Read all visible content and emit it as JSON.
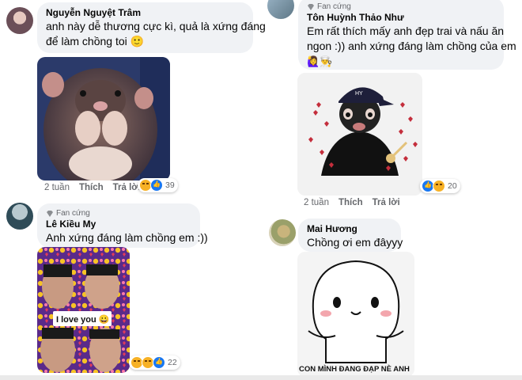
{
  "comments": [
    {
      "name": "Nguyễn Nguyệt Trâm",
      "text_lines": [
        "anh này dễ thương cực kì, quả là xứng đáng",
        "để làm chồng toi 🙂"
      ],
      "time": "2 tuần",
      "like_label": "Thích",
      "reply_label": "Trả lời",
      "reaction_count": "39"
    },
    {
      "badge": "Fan cứng",
      "name": "Tôn Huỳnh Thảo Như",
      "text_lines": [
        "Em rất thích mấy anh đẹp trai và nấu ăn",
        "ngon :)) anh xứng đáng làm chồng của em",
        "🙋‍♀️👨‍🍳"
      ],
      "time": "2 tuần",
      "like_label": "Thích",
      "reply_label": "Trả lời",
      "reaction_count": "20",
      "sticker_text": "HY"
    },
    {
      "badge": "Fan cứng",
      "name": "Lê Kiều My",
      "text_lines": [
        "Anh xứng đáng làm chồng em :))"
      ],
      "reaction_count": "22",
      "photo_caption": "I love you 😀"
    },
    {
      "name": "Mai Hương",
      "text_lines": [
        "Chồng ơi em đâyyy"
      ],
      "meme_caption": "CON MÌNH ĐANG ĐẠP NÈ ANH"
    }
  ],
  "colors": {
    "bubble": "#f0f2f5",
    "like": "#1877f2",
    "meta": "#65676b"
  }
}
